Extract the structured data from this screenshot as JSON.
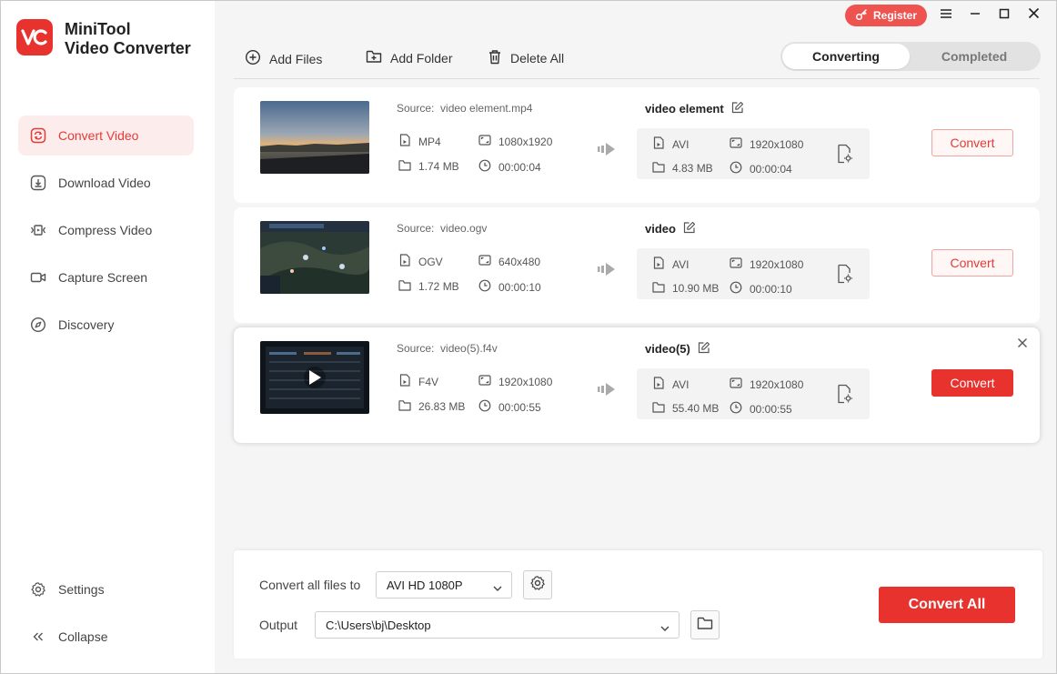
{
  "app": {
    "title_line1": "MiniTool",
    "title_line2": "Video Converter",
    "logo_text": "VC",
    "register_label": "Register"
  },
  "sidebar": {
    "items": [
      {
        "label": "Convert Video",
        "icon": "convert-icon",
        "active": true
      },
      {
        "label": "Download Video",
        "icon": "download-icon"
      },
      {
        "label": "Compress Video",
        "icon": "compress-icon"
      },
      {
        "label": "Capture Screen",
        "icon": "camera-icon"
      },
      {
        "label": "Discovery",
        "icon": "compass-icon"
      }
    ],
    "settings_label": "Settings",
    "collapse_label": "Collapse"
  },
  "toolbar": {
    "add_files": "Add Files",
    "add_folder": "Add Folder",
    "delete_all": "Delete All",
    "tab_converting": "Converting",
    "tab_completed": "Completed"
  },
  "files": [
    {
      "source_label": "Source:",
      "source": "video element.mp4",
      "format": "MP4",
      "resolution": "1080x1920",
      "size": "1.74 MB",
      "duration": "00:00:04",
      "output_name": "video element",
      "out_format": "AVI",
      "out_resolution": "1920x1080",
      "out_size": "4.83 MB",
      "out_duration": "00:00:04",
      "convert_label": "Convert"
    },
    {
      "source_label": "Source:",
      "source": "video.ogv",
      "format": "OGV",
      "resolution": "640x480",
      "size": "1.72 MB",
      "duration": "00:00:10",
      "output_name": "video",
      "out_format": "AVI",
      "out_resolution": "1920x1080",
      "out_size": "10.90 MB",
      "out_duration": "00:00:10",
      "convert_label": "Convert"
    },
    {
      "source_label": "Source:",
      "source": "video(5).f4v",
      "format": "F4V",
      "resolution": "1920x1080",
      "size": "26.83 MB",
      "duration": "00:00:55",
      "output_name": "video(5)",
      "out_format": "AVI",
      "out_resolution": "1920x1080",
      "out_size": "55.40 MB",
      "out_duration": "00:00:55",
      "convert_label": "Convert"
    }
  ],
  "bottom": {
    "convert_all_to_label": "Convert all files to",
    "format_value": "AVI HD 1080P",
    "output_label": "Output",
    "output_path": "C:\\Users\\bj\\Desktop",
    "convert_all_label": "Convert All"
  },
  "colors": {
    "accent": "#e8322d",
    "active_bg": "#fdecec"
  }
}
